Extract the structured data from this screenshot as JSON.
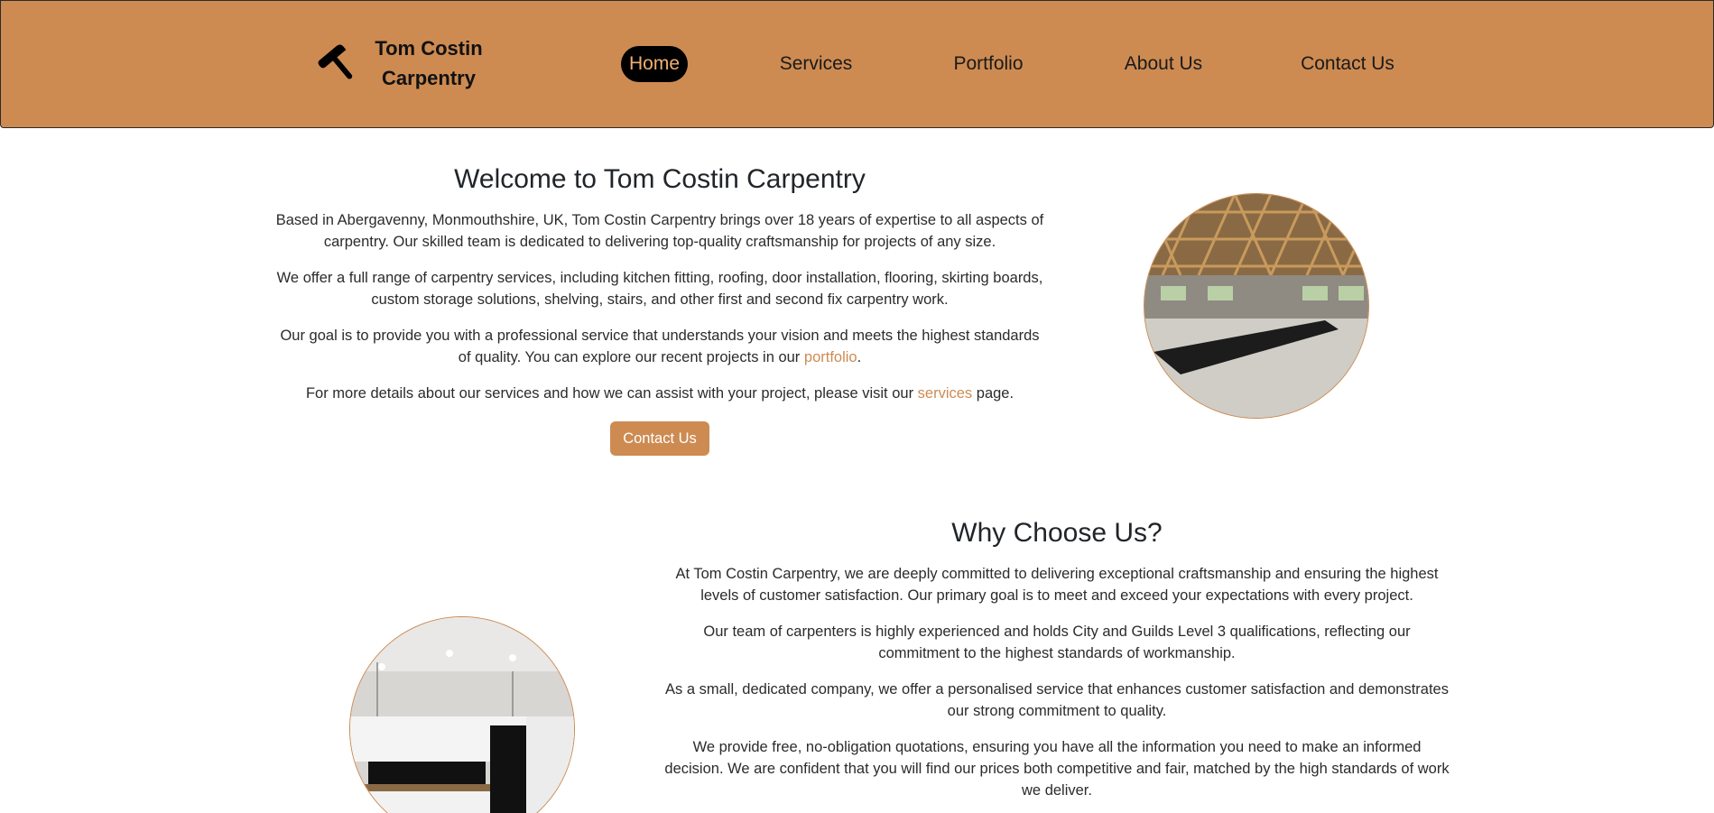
{
  "brand": {
    "name_line1": "Tom Costin",
    "name_line2": "Carpentry",
    "icon": "hammer-icon"
  },
  "nav": {
    "home": "Home",
    "services": "Services",
    "portfolio": "Portfolio",
    "about": "About Us",
    "contact": "Contact Us",
    "active": "Home"
  },
  "welcome": {
    "title": "Welcome to Tom Costin Carpentry",
    "p1": "Based in Abergavenny, Monmouthshire, UK, Tom Costin Carpentry brings over 18 years of expertise to all aspects of carpentry. Our skilled team is dedicated to delivering top-quality craftsmanship for projects of any size.",
    "p2": "We offer a full range of carpentry services, including kitchen fitting, roofing, door installation, flooring, skirting boards, custom storage solutions, shelving, stairs, and other first and second fix carpentry work.",
    "p3_before": "Our goal is to provide you with a professional service that understands your vision and meets the highest standards of quality. You can explore our recent projects in our ",
    "p3_link": "portfolio",
    "p3_after": ".",
    "p4_before": "For more details about our services and how we can assist with your project, please visit our ",
    "p4_link": "services",
    "p4_after": " page.",
    "button": "Contact Us"
  },
  "why": {
    "title": "Why Choose Us?",
    "p1": "At Tom Costin Carpentry, we are deeply committed to delivering exceptional craftsmanship and ensuring the highest levels of customer satisfaction. Our primary goal is to meet and exceed your expectations with every project.",
    "p2": "Our team of carpenters is highly experienced and holds City and Guilds Level 3 qualifications, reflecting our commitment to the highest standards of workmanship.",
    "p3": "As a small, dedicated company, we offer a personalised service that enhances customer satisfaction and demonstrates our strong commitment to quality.",
    "p4": "We provide free, no-obligation quotations, ensuring you have all the information you need to make an informed decision. We are confident that you will find our prices both competitive and fair, matched by the high standards of work we deliver."
  },
  "colors": {
    "brand": "#cd8b52",
    "nav_active_bg": "#000000",
    "nav_active_text": "#f0b072"
  }
}
